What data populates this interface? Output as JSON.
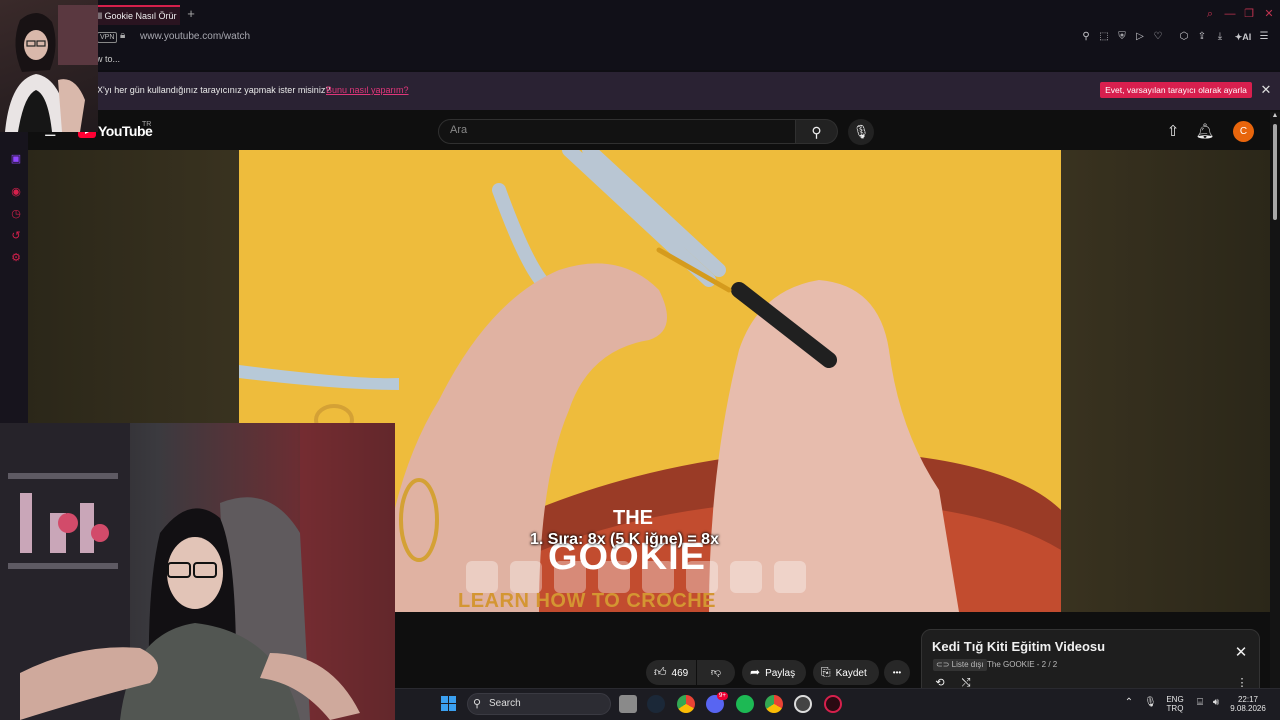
{
  "browser": {
    "tab_title": "ll Gookie Nasıl Örür",
    "new_tab": "+",
    "vpn_badge": "VPN",
    "url": "www.youtube.com/watch",
    "bookmark": "w to...",
    "infobar": {
      "message": "X'yı her gün kullandığınız tarayıcınız yapmak ister misiniz?",
      "link": "Bunu nasıl yaparım?",
      "button": "Evet, varsayılan tarayıcı olarak ayarla",
      "close": "✕"
    },
    "ai_label": "AI"
  },
  "youtube": {
    "logo_text": "YouTube",
    "country": "TR",
    "search_placeholder": "Ara",
    "avatar_letter": "C"
  },
  "video": {
    "caption": "1. Sıra: 8x (5 K iğne) = 8x",
    "logo_the": "THE",
    "logo_gookie": "GOOKIE",
    "logo_tagline": "LEARN HOW TO CROCHE"
  },
  "actions": {
    "like_count": "469",
    "share": "Paylaş",
    "save": "Kaydet",
    "more": "•••"
  },
  "playlist": {
    "title": "Kedi Tığ Kiti Eğitim Videosu",
    "badge": "Liste dışı",
    "channel_and_position": "The GOOKIE - 2 / 2",
    "close": "✕"
  },
  "taskbar": {
    "search_label": "Search",
    "language_top": "ENG",
    "language_bottom": "TRQ",
    "time": "22:17",
    "date": "9.08.2026",
    "discord_badge": "9+"
  },
  "colors": {
    "accent": "#d6204c",
    "youtube_red": "#ff0033",
    "avatar_orange": "#e8650c",
    "video_background": "#eebc3c"
  }
}
